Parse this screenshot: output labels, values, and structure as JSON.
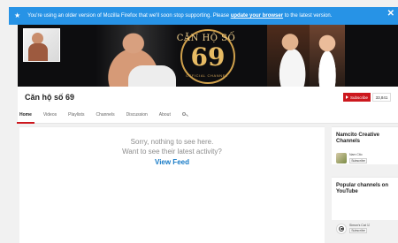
{
  "notice": {
    "prefix": "You're using an older version of Mozilla Firefox that we'll soon stop supporting. Please ",
    "link": "update your browser",
    "suffix": " to the latest version.",
    "close": "✕"
  },
  "banner": {
    "logo_title": "CĂN HỘ SỐ",
    "logo_number": "69",
    "logo_sub": "OFFICIAL CHANNEL"
  },
  "header": {
    "channel_title": "Căn hộ số 69",
    "subscribe_label": "Subscribe",
    "subscriber_count": "33,841",
    "tabs": [
      "Home",
      "Videos",
      "Playlists",
      "Channels",
      "Discussion",
      "About"
    ]
  },
  "main": {
    "empty_line_1": "Sorry, nothing to see here.",
    "empty_line_2": "Want to see their latest activity?",
    "view_feed": "View Feed"
  },
  "sidebar": {
    "featured": {
      "title": "Namcito Creative Channels",
      "channel_name": "Nam Cito",
      "subscribe_label": "Subscribe"
    },
    "popular": {
      "title": "Popular channels on YouTube",
      "channel_name": "Simon's Cat",
      "verified": "☑",
      "subscribe_label": "Subscribe"
    }
  },
  "colors": {
    "notice_blue": "#2793e6",
    "youtube_red": "#cc181e",
    "link_blue": "#167ac6"
  }
}
